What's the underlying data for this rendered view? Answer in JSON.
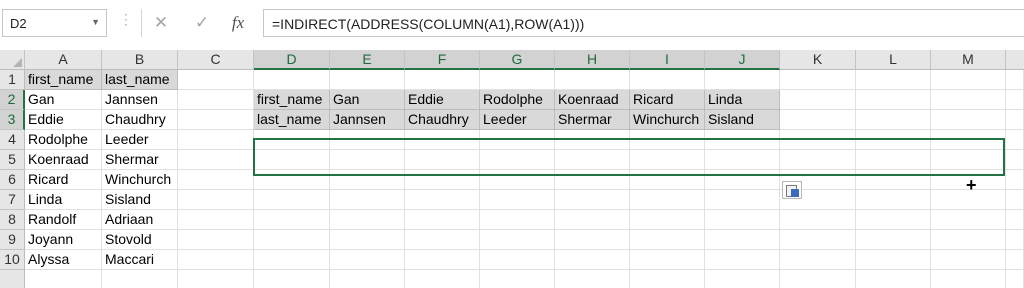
{
  "name_box": "D2",
  "formula": "=INDIRECT(ADDRESS(COLUMN(A1),ROW(A1)))",
  "toolbar": {
    "cancel": "✕",
    "enter": "✓",
    "fx": "fx"
  },
  "columns": [
    "A",
    "B",
    "C",
    "D",
    "E",
    "F",
    "G",
    "H",
    "I",
    "J",
    "K",
    "L",
    "M"
  ],
  "rows": [
    "1",
    "2",
    "3",
    "4",
    "5",
    "6",
    "7",
    "8",
    "9",
    "10"
  ],
  "col_a": [
    "first_name",
    "Gan",
    "Eddie",
    "Rodolphe",
    "Koenraad",
    "Ricard",
    "Linda",
    "Randolf",
    "Joyann",
    "Alyssa"
  ],
  "col_b": [
    "last_name",
    "Jannsen",
    "Chaudhry",
    "Leeder",
    "Shermar",
    "Winchurch",
    "Sisland",
    "Adriaan",
    "Stovold",
    "Maccari"
  ],
  "row2": [
    "first_name",
    "Gan",
    "Eddie",
    "Rodolphe",
    "Koenraad",
    "Ricard",
    "Linda"
  ],
  "row3": [
    "last_name",
    "Jannsen",
    "Chaudhry",
    "Leeder",
    "Shermar",
    "Winchurch",
    "Sisland"
  ],
  "cursor_glyph": "+",
  "colors": {
    "accent": "#217346",
    "header_bg": "#e6e6e6",
    "header_fill": "#d9d9d9"
  }
}
